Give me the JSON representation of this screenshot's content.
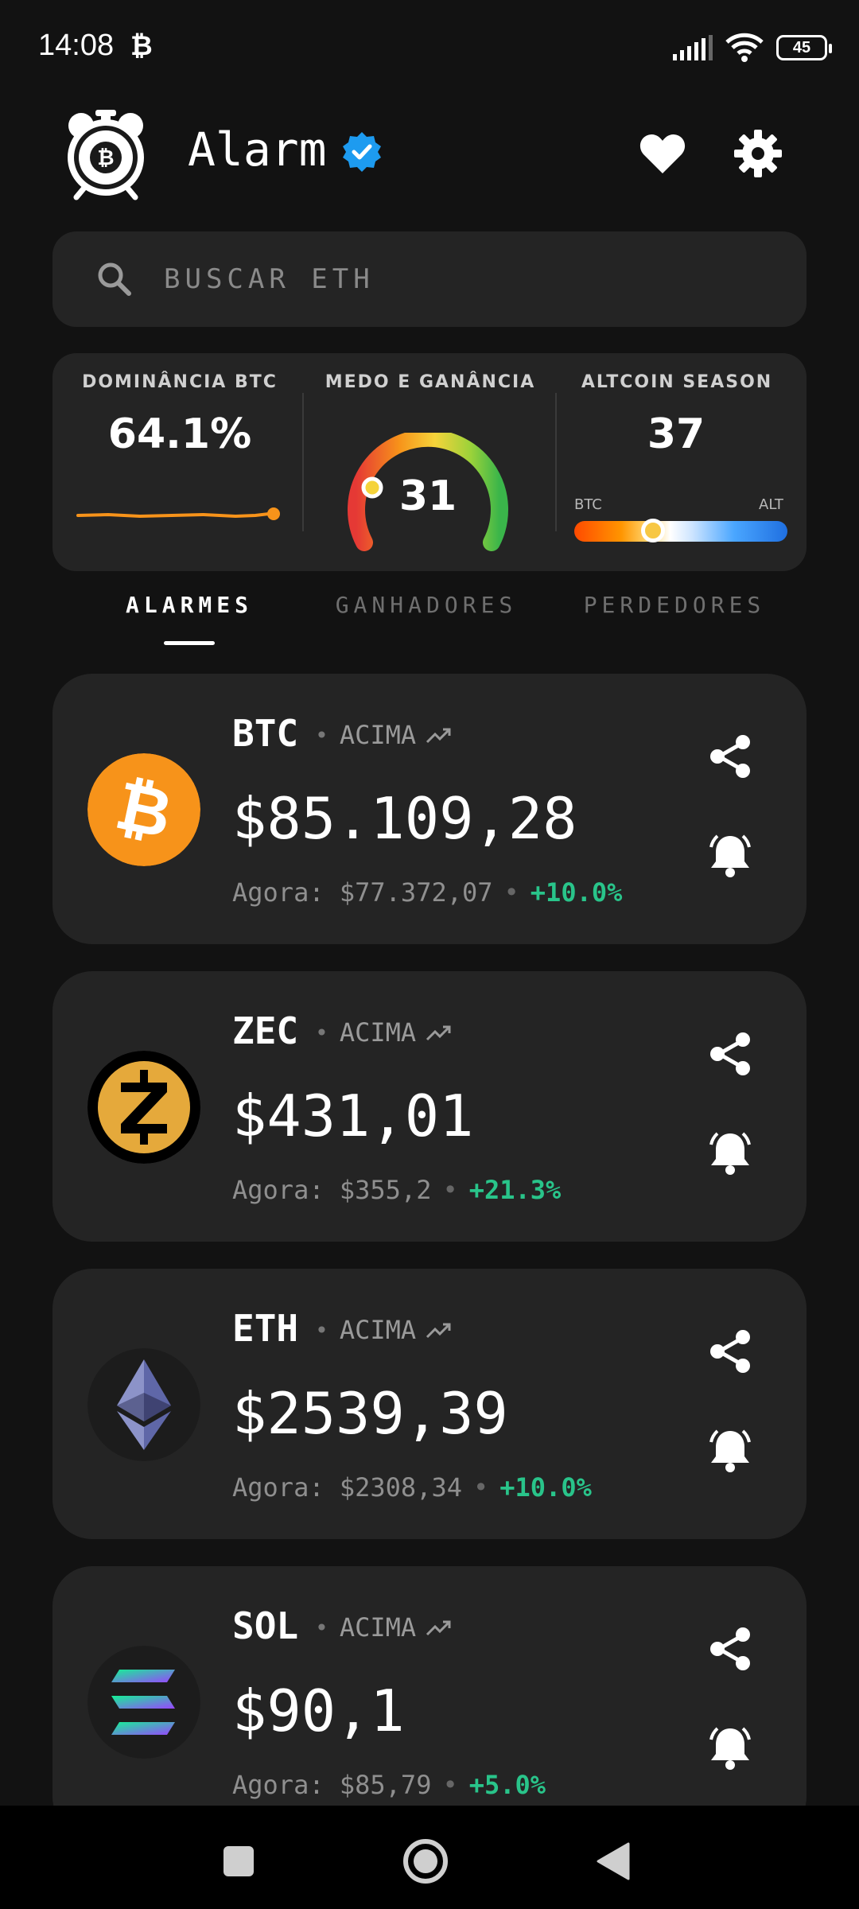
{
  "status_bar": {
    "time": "14:08",
    "notif_symbol": "₿",
    "battery": "45"
  },
  "header": {
    "title": "Alarm"
  },
  "search": {
    "placeholder": "BUSCAR ETH"
  },
  "metrics": {
    "dominance": {
      "title": "DOMINÂNCIA BTC",
      "value": "64.1%"
    },
    "fear_greed": {
      "title": "MEDO E GANÂNCIA",
      "value": "31",
      "level": 0.31
    },
    "altseason": {
      "title": "ALTCOIN SEASON",
      "value": "37",
      "left_label": "BTC",
      "right_label": "ALT",
      "level": 0.37
    }
  },
  "tabs": [
    {
      "label": "ALARMES",
      "active": true
    },
    {
      "label": "GANHADORES",
      "active": false
    },
    {
      "label": "PERDEDORES",
      "active": false
    }
  ],
  "alarms": [
    {
      "symbol": "BTC",
      "direction": "ACIMA",
      "target": "$85.109,28",
      "now_label": "Agora: $77.372,07",
      "change": "+10.0%"
    },
    {
      "symbol": "ZEC",
      "direction": "ACIMA",
      "target": "$431,01",
      "now_label": "Agora: $355,2",
      "change": "+21.3%"
    },
    {
      "symbol": "ETH",
      "direction": "ACIMA",
      "target": "$2539,39",
      "now_label": "Agora: $2308,34",
      "change": "+10.0%"
    },
    {
      "symbol": "SOL",
      "direction": "ACIMA",
      "target": "$90,1",
      "now_label": "Agora: $85,79",
      "change": "+5.0%"
    }
  ],
  "colors": {
    "background": "#121212",
    "card": "#242424",
    "positive": "#29c48a",
    "accent_orange": "#f7931a",
    "verified_blue": "#1d9bf0"
  }
}
